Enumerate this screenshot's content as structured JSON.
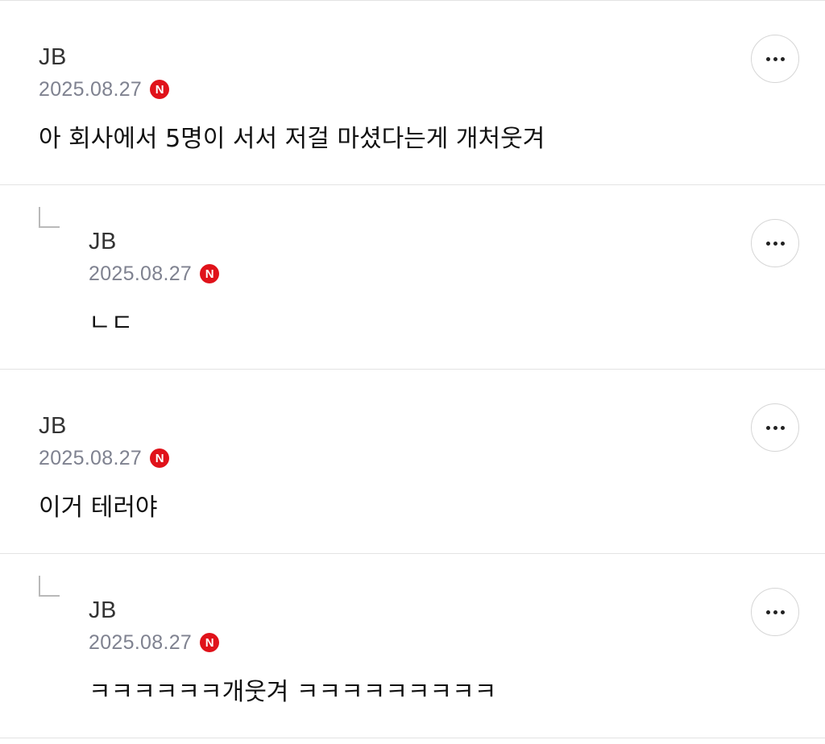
{
  "comments": [
    {
      "author": "JB",
      "date": "2025.08.27",
      "badge": "N",
      "text": "아 회사에서 5명이 서서 저걸 마셨다는게 개처웃겨",
      "is_reply": false
    },
    {
      "author": "JB",
      "date": "2025.08.27",
      "badge": "N",
      "text": "ㄴㄷ",
      "is_reply": true
    },
    {
      "author": "JB",
      "date": "2025.08.27",
      "badge": "N",
      "text": "이거 테러야",
      "is_reply": false
    },
    {
      "author": "JB",
      "date": "2025.08.27",
      "badge": "N",
      "text": "ㅋㅋㅋㅋㅋㅋ개웃겨 ㅋㅋㅋㅋㅋㅋㅋㅋㅋ",
      "is_reply": true
    }
  ],
  "icons": {
    "more": "more-horizontal-icon",
    "reply": "reply-arrow-icon",
    "new": "new-badge-icon"
  },
  "colors": {
    "badge": "#e0121a",
    "date": "#7f8290",
    "divider": "#e3e3e3"
  }
}
